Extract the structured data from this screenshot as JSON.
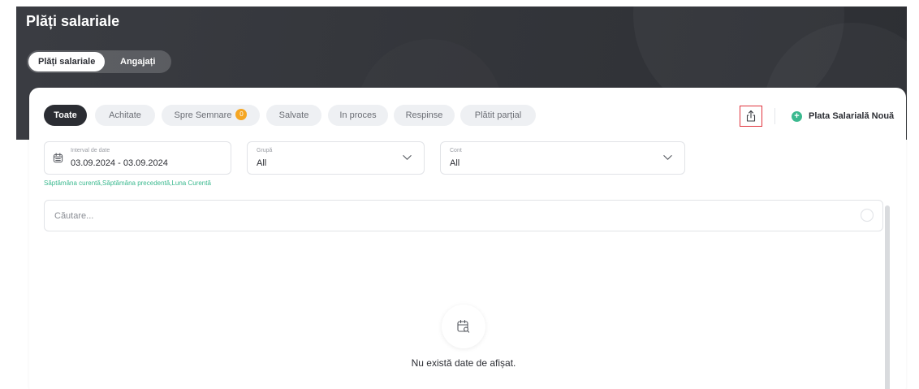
{
  "header": {
    "title": "Plăți salariale",
    "view_tabs": [
      "Plăți salariale",
      "Angajați"
    ]
  },
  "filters": {
    "tabs": [
      {
        "label": "Toate",
        "active": true
      },
      {
        "label": "Achitate"
      },
      {
        "label": "Spre Semnare",
        "badge": "0"
      },
      {
        "label": "Salvate"
      },
      {
        "label": "In proces"
      },
      {
        "label": "Respinse"
      },
      {
        "label": "Plătit parțial"
      }
    ],
    "date_range": {
      "label": "Interval de date",
      "value": "03.09.2024 - 03.09.2024"
    },
    "group": {
      "label": "Grupă",
      "value": "All"
    },
    "account": {
      "label": "Cont",
      "value": "All"
    },
    "quick_dates": "Săptămâna curentă,Săptămâna precedentă,Luna Curentă"
  },
  "actions": {
    "export_icon": "upload-icon",
    "new_payment": "Plata Salarială Nouă"
  },
  "search": {
    "placeholder": "Căutare..."
  },
  "empty_state": {
    "icon": "calendar-search-icon",
    "message": "Nu există date de afișat."
  },
  "colors": {
    "accent_green": "#3bb98f",
    "badge_orange": "#f5a623",
    "dark": "#2b2d33",
    "highlight_red": "#e0333d"
  }
}
